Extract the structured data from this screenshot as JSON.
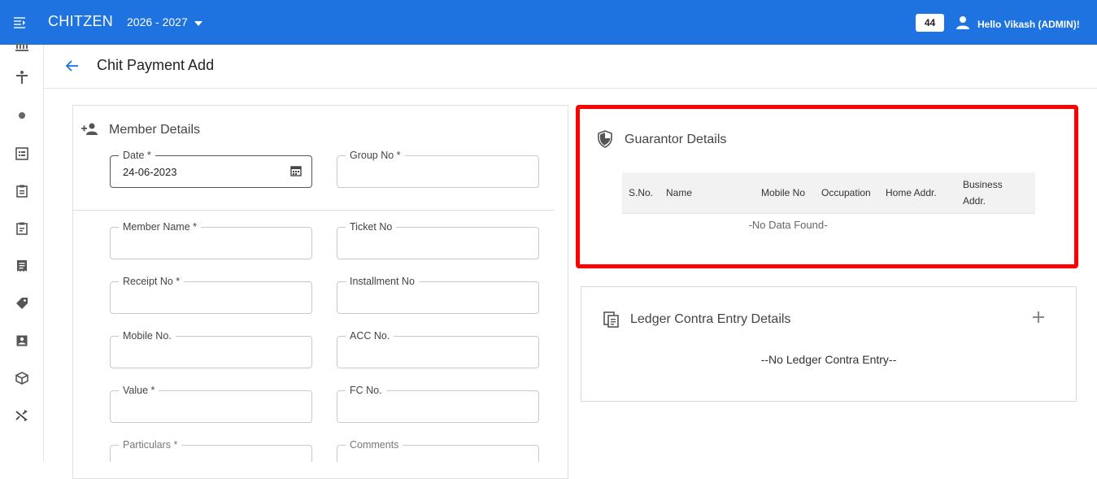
{
  "topbar": {
    "brand": "CHITZEN",
    "year": "2026 - 2027",
    "badge": "44",
    "user": "Hello Vikash (ADMIN)!"
  },
  "page": {
    "title": "Chit Payment Add"
  },
  "member": {
    "title": "Member Details",
    "fields": {
      "date": {
        "label": "Date *",
        "value": "24-06-2023"
      },
      "group_no": {
        "label": "Group No *"
      },
      "member_name": {
        "label": "Member Name *"
      },
      "ticket_no": {
        "label": "Ticket No"
      },
      "receipt_no": {
        "label": "Receipt No *"
      },
      "installment_no": {
        "label": "Installment No"
      },
      "mobile_no": {
        "label": "Mobile No."
      },
      "acc_no": {
        "label": "ACC No."
      },
      "value": {
        "label": "Value *"
      },
      "fc_no": {
        "label": "FC No."
      },
      "particulars": {
        "label": "Particulars *"
      },
      "comments": {
        "label": "Comments"
      }
    }
  },
  "guarantor": {
    "title": "Guarantor Details",
    "columns": [
      "S.No.",
      "Name",
      "Mobile No",
      "Occupation",
      "Home Addr.",
      "Business",
      "Addr."
    ],
    "empty": "-No Data Found-"
  },
  "ledger": {
    "title": "Ledger Contra Entry Details",
    "empty": "--No Ledger Contra Entry--"
  },
  "colors": {
    "primary": "#1e73e0",
    "highlight": "#ff0000"
  }
}
